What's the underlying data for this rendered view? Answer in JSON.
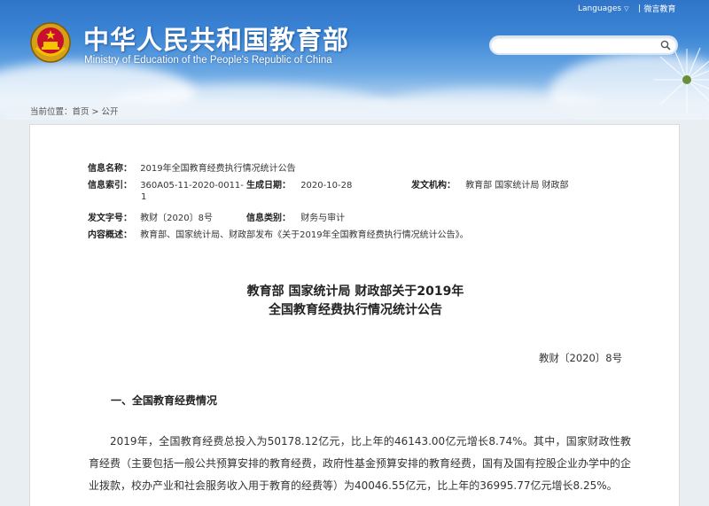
{
  "header": {
    "title_cn": "中华人民共和国教育部",
    "title_en": "Ministry of Education of the People's Republic of China",
    "languages_label": "Languages",
    "weibo_label": "微言教育",
    "search": {
      "placeholder": "",
      "value": ""
    }
  },
  "breadcrumb": {
    "prefix": "当前位置：",
    "home": "首页",
    "separator": ">",
    "current": "公开"
  },
  "meta": {
    "info_name_label": "信息名称：",
    "info_name": "2019年全国教育经费执行情况统计公告",
    "index_label": "信息索引：",
    "index_line1": "360A05-11-2020-0011-",
    "index_line2": "1",
    "date_label": "生成日期：",
    "date": "2020-10-28",
    "issuer_label": "发文机构：",
    "issuer": "教育部 国家统计局 财政部",
    "doc_no_label": "发文字号：",
    "doc_no": "教财〔2020〕8号",
    "category_label": "信息类别：",
    "category": "财务与审计",
    "summary_label": "内容概述：",
    "summary": "教育部、国家统计局、财政部发布《关于2019年全国教育经费执行情况统计公告》。"
  },
  "article": {
    "title_line1": "教育部 国家统计局 财政部关于2019年",
    "title_line2": "全国教育经费执行情况统计公告",
    "doc_number": "教财〔2020〕8号",
    "section1_heading": "一、全国教育经费情况",
    "paragraph1": "2019年，全国教育经费总投入为50178.12亿元，比上年的46143.00亿元增长8.74%。其中，国家财政性教育经费（主要包括一般公共预算安排的教育经费，政府性基金预算安排的教育经费，国有及国有控股企业办学中的企业拨款，校办产业和社会服务收入用于教育的经费等）为40046.55亿元，比上年的36995.77亿元增长8.25%。"
  }
}
